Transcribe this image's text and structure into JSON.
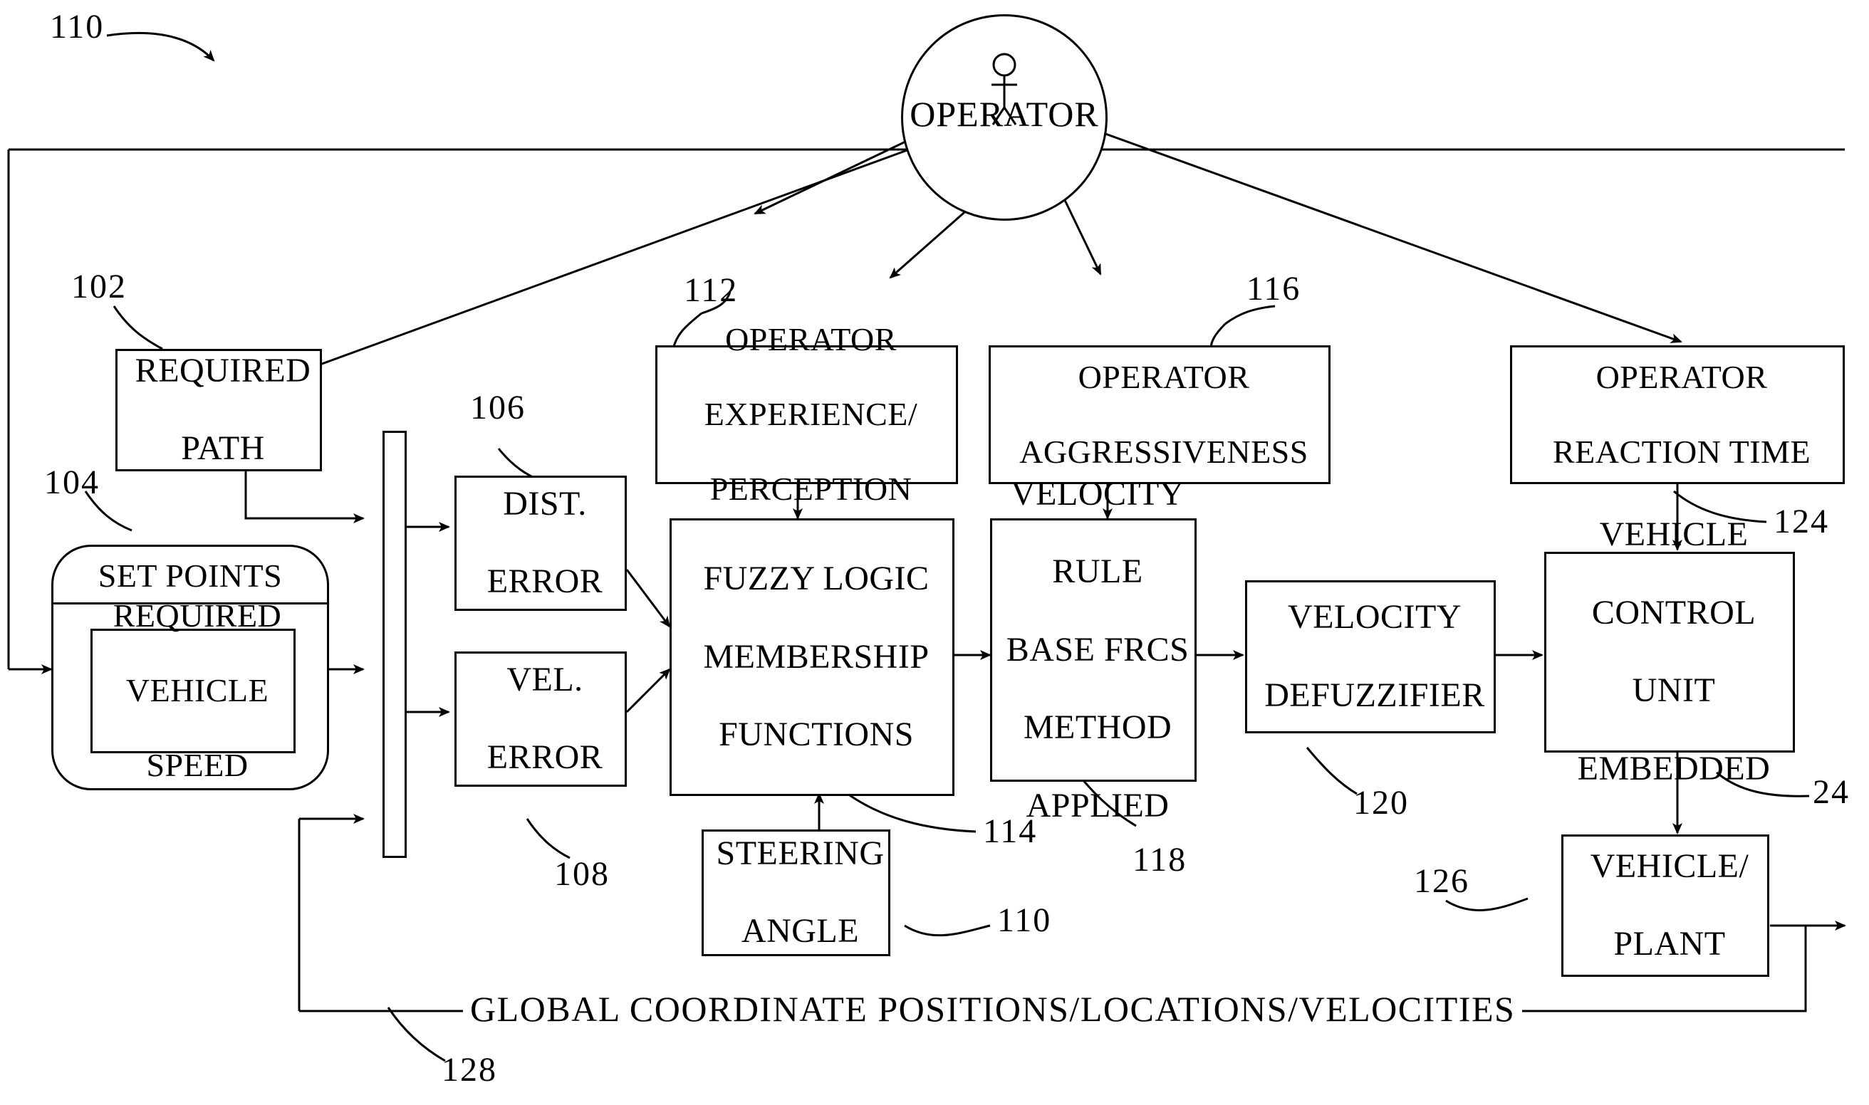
{
  "figure": {
    "title_label": "110",
    "bottom_bus_text": "GLOBAL COORDINATE POSITIONS/LOCATIONS/VELOCITIES"
  },
  "nodes": {
    "operator": {
      "label": "OPERATOR",
      "icon": "person-icon"
    },
    "required_path": {
      "label": "REQUIRED PATH",
      "ref": "102"
    },
    "set_points": {
      "label": "SET POINTS",
      "inner_label": "REQUIRED VEHICLE SPEED",
      "ref": "104"
    },
    "dist_error": {
      "label": "DIST. ERROR",
      "ref": "106"
    },
    "vel_error": {
      "label": "VEL. ERROR",
      "ref": "108"
    },
    "operator_experience": {
      "label": "OPERATOR EXPERIENCE/ PERCEPTION",
      "ref": "112"
    },
    "operator_aggressiveness": {
      "label": "OPERATOR AGGRESSIVENESS",
      "ref": "116"
    },
    "operator_reaction_time": {
      "label": "OPERATOR REACTION TIME",
      "ref": "124"
    },
    "fuzzy_logic": {
      "label": "FUZZY LOGIC MEMBERSHIP FUNCTIONS",
      "ref": "114"
    },
    "velocity_rule_base": {
      "label": "VELOCITY RULE BASE FRCS METHOD APPLIED",
      "ref": "118"
    },
    "velocity_defuzzifier": {
      "label": "VELOCITY DEFUZZIFIER",
      "ref": "120"
    },
    "vehicle_control_unit": {
      "label": "VEHICLE CONTROL UNIT EMBEDDED",
      "ref": "24"
    },
    "vehicle_plant": {
      "label": "VEHICLE/ PLANT",
      "ref": "126"
    },
    "steering_angle": {
      "label": "STEERING ANGLE",
      "ref": "110"
    },
    "feedback_bus": {
      "ref": "128"
    }
  },
  "node_lines": {
    "required_path": [
      "REQUIRED",
      "PATH"
    ],
    "set_points_inner": [
      "REQUIRED",
      "VEHICLE",
      "SPEED"
    ],
    "dist_error": [
      "DIST.",
      "ERROR"
    ],
    "vel_error": [
      "VEL.",
      "ERROR"
    ],
    "operator_experience": [
      "OPERATOR",
      "EXPERIENCE/",
      "PERCEPTION"
    ],
    "operator_aggressiveness": [
      "OPERATOR",
      "AGGRESSIVENESS"
    ],
    "operator_reaction_time": [
      "OPERATOR",
      "REACTION TIME"
    ],
    "fuzzy_logic": [
      "FUZZY LOGIC",
      "MEMBERSHIP",
      "FUNCTIONS"
    ],
    "velocity_rule_base": [
      "VELOCITY",
      "RULE",
      "BASE FRCS",
      "METHOD",
      "APPLIED"
    ],
    "velocity_defuzzifier": [
      "VELOCITY",
      "DEFUZZIFIER"
    ],
    "vehicle_control_unit": [
      "VEHICLE",
      "CONTROL",
      "UNIT",
      "EMBEDDED"
    ],
    "vehicle_plant": [
      "VEHICLE/",
      "PLANT"
    ],
    "steering_angle": [
      "STEERING",
      "ANGLE"
    ]
  },
  "colors": {
    "ink": "#000000",
    "paper": "#ffffff"
  }
}
